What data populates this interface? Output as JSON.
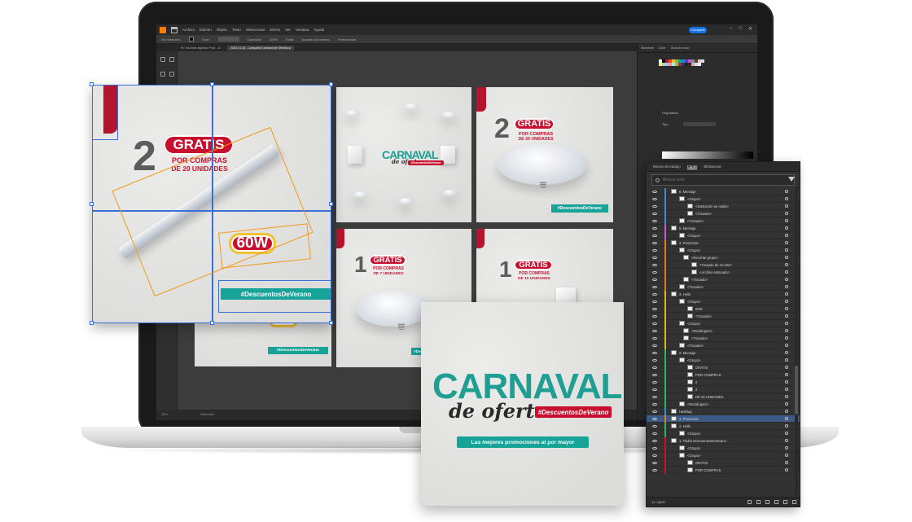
{
  "illustrator": {
    "menu": [
      "Archivo",
      "Edición",
      "Objeto",
      "Texto",
      "Seleccionar",
      "Efecto",
      "Ver",
      "Ventana",
      "Ayuda"
    ],
    "share_label": "Compartir",
    "tabs": [
      {
        "label": "EK Medidas digitales Prod…Ai",
        "active": false
      },
      {
        "label": "2023-01-18 - Campaña Carnaval de Ofertas.ai",
        "active": true
      }
    ],
    "control_bar": {
      "selection_label": "Sin selección",
      "stroke_label": "Trazo",
      "opacity_label": "Opacidad",
      "opacity_value": "100%",
      "style_label": "Estilo",
      "doc_setup_label": "Ajustes documento",
      "prefs_label": "Preferencias"
    },
    "status": {
      "zoom": "15%",
      "mode": "Selección"
    },
    "right_tabs": [
      "Muestras",
      "Color",
      "Guía de color"
    ],
    "gradient_label": "Degradado",
    "type_label": "Tipo"
  },
  "designs": {
    "card_a": {
      "number": "2",
      "pill": "GRATIS",
      "sub_line1": "POR COMPRAS",
      "sub_line2": "DE 20 UNIDADES",
      "watt": "60W",
      "hashtag": "#DescuentosDeVerano"
    },
    "card_b": {
      "title": "CARNAVAL",
      "script": "de ofertas",
      "hashtag": "#DescuentosDeVerano"
    },
    "card_c": {
      "number": "2",
      "pill": "GRATIS",
      "sub_line1": "POR COMPRAS",
      "sub_line2": "DE 20 UNIDADES",
      "hashtag": "#DescuentosDeVerano"
    },
    "card_d": {
      "number": "1",
      "pill": "GRATIS",
      "sub_line1": "POR COMPRAS",
      "sub_line2": "DE 7 UNIDADES",
      "hashtag": "#Desc"
    },
    "card_e": {
      "number": "1",
      "pill": "GRATIS",
      "sub_line1": "POR COMPRAS",
      "sub_line2": "DE 10 UNIDADES"
    },
    "card_f": {
      "hashtag": "#DescuentosDeVerano",
      "watt": "60W"
    },
    "card_main": {
      "title": "CARNAVAL",
      "script": "de ofertas",
      "hashtag": "#DescuentosDeVerano",
      "tagline": "Las mejores promociones al por mayor"
    }
  },
  "layers_panel": {
    "tabs": [
      {
        "label": "Mesas de trabajo",
        "active": false
      },
      {
        "label": "Capas",
        "active": true
      },
      {
        "label": "Bibliotecas",
        "active": false
      }
    ],
    "search_placeholder": "Buscar todo",
    "rows": [
      {
        "name": "6. Mensaje",
        "indent": 0,
        "color": "#3a8ddc"
      },
      {
        "name": "<Grupo>",
        "indent": 2,
        "color": "#3a8ddc"
      },
      {
        "name": "<Ilustración en malla>",
        "indent": 4,
        "color": "#3a8ddc"
      },
      {
        "name": "<Trazado>",
        "indent": 4,
        "color": "#3a8ddc"
      },
      {
        "name": "<Trazado>",
        "indent": 2,
        "color": "#3a8ddc"
      },
      {
        "name": "5. Mensaje",
        "indent": 0,
        "color": "#c85ad8"
      },
      {
        "name": "<Grupo>",
        "indent": 2,
        "color": "#c85ad8"
      },
      {
        "name": "4. Productos",
        "indent": 0,
        "color": "#e07b1f"
      },
      {
        "name": "<Grupo>",
        "indent": 2,
        "color": "#e07b1f"
      },
      {
        "name": "<Recortar grupo>",
        "indent": 3,
        "color": "#e07b1f"
      },
      {
        "name": "<Trazado de recorte>",
        "indent": 5,
        "color": "#e07b1f"
      },
      {
        "name": "<Archivo enlazado>",
        "indent": 5,
        "color": "#e07b1f"
      },
      {
        "name": "<Trazado>",
        "indent": 3,
        "color": "#e07b1f"
      },
      {
        "name": "<Trazado>",
        "indent": 2,
        "color": "#e07b1f"
      },
      {
        "name": "3. Hello",
        "indent": 0,
        "color": "#e0b31f"
      },
      {
        "name": "<Grupo>",
        "indent": 2,
        "color": "#e0b31f"
      },
      {
        "name": "60W",
        "indent": 4,
        "color": "#e0b31f"
      },
      {
        "name": "<Trazado>",
        "indent": 4,
        "color": "#e0b31f"
      },
      {
        "name": "<Grupo>",
        "indent": 2,
        "color": "#e0b31f"
      },
      {
        "name": "<Rectángulo>",
        "indent": 3,
        "color": "#e0b31f"
      },
      {
        "name": "<Trazado>",
        "indent": 3,
        "color": "#e0b31f"
      },
      {
        "name": "<Trazado>",
        "indent": 2,
        "color": "#e0b31f"
      },
      {
        "name": "2. Mensaje",
        "indent": 0,
        "color": "#2fb36b"
      },
      {
        "name": "<Grupo>",
        "indent": 2,
        "color": "#2fb36b"
      },
      {
        "name": "GRATIS",
        "indent": 4,
        "color": "#2fb36b"
      },
      {
        "name": "POR COMPRAS",
        "indent": 4,
        "color": "#2fb36b"
      },
      {
        "name": "2",
        "indent": 4,
        "color": "#2fb36b"
      },
      {
        "name": "2",
        "indent": 4,
        "color": "#2fb36b"
      },
      {
        "name": "DE 20 UNIDADES",
        "indent": 4,
        "color": "#2fb36b"
      },
      {
        "name": "<Rectángulo>",
        "indent": 2,
        "color": "#2fb36b"
      },
      {
        "name": "Hashtag",
        "indent": 0,
        "color": "#3a8ddc"
      },
      {
        "name": "2. Productos",
        "indent": 0,
        "color": "#e07b1f",
        "selected": true
      },
      {
        "name": "2. Hello",
        "indent": 0,
        "color": "#2fb36b"
      },
      {
        "name": "<Grupo>",
        "indent": 2,
        "color": "#2fb36b"
      },
      {
        "name": "1. Titular DescuentosDeVerano",
        "indent": 0,
        "color": "#c8102e"
      },
      {
        "name": "<Grupo>",
        "indent": 2,
        "color": "#c8102e"
      },
      {
        "name": "<Grupo>",
        "indent": 2,
        "color": "#c8102e"
      },
      {
        "name": "GRATIS",
        "indent": 4,
        "color": "#c8102e"
      },
      {
        "name": "POR COMPRAS",
        "indent": 4,
        "color": "#c8102e"
      }
    ],
    "footer_count": "11 capas"
  },
  "colors": {
    "brand_red": "#c8102e",
    "brand_teal": "#17a398",
    "selection_blue": "#3a6fd8",
    "guide_orange": "#f29a1d"
  }
}
